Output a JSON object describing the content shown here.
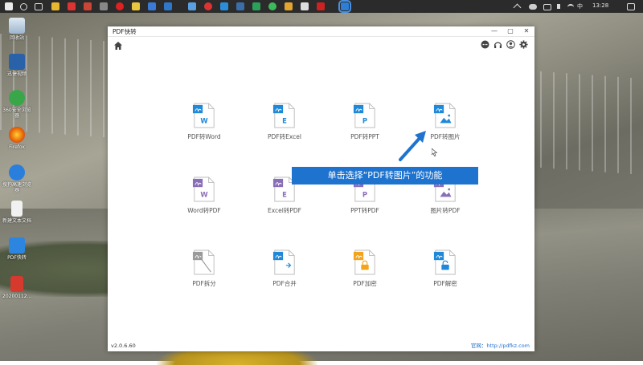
{
  "taskbar": {
    "tray": {
      "input_method": "中",
      "time": "13:28"
    }
  },
  "desktop": {
    "icons": [
      {
        "label": "回收站",
        "icon": "recycle-bin-icon"
      },
      {
        "label": "迅捷视频",
        "icon": "jm-app-icon"
      },
      {
        "label": "360安全浏览器",
        "icon": "360-browser-icon"
      },
      {
        "label": "Firefox",
        "icon": "firefox-icon"
      },
      {
        "label": "搜狗高速浏览器",
        "icon": "sogou-browser-icon"
      },
      {
        "label": "新建文本文档",
        "icon": "text-document-icon"
      },
      {
        "label": "PDF快转",
        "icon": "pdf-kuaizhuan-icon"
      },
      {
        "label": "20200112...",
        "icon": "pdf-file-icon"
      }
    ]
  },
  "window": {
    "title": "PDF快转",
    "controls": [
      "—",
      "▢",
      "✕"
    ],
    "toolbar_icons": [
      "chat-icon",
      "headset-icon",
      "user-icon",
      "gear-icon"
    ],
    "tiles": [
      {
        "label": "PDF转Word",
        "letter": "W",
        "accent": "#1f88d8"
      },
      {
        "label": "PDF转Excel",
        "letter": "E",
        "accent": "#1f88d8"
      },
      {
        "label": "PDF转PPT",
        "letter": "P",
        "accent": "#1f88d8"
      },
      {
        "label": "PDF转图片",
        "letter": "",
        "accent": "#1f88d8"
      },
      {
        "label": "Word转PDF",
        "letter": "W",
        "accent": "#8a6fb8"
      },
      {
        "label": "Excel转PDF",
        "letter": "E",
        "accent": "#8a6fb8"
      },
      {
        "label": "PPT转PDF",
        "letter": "P",
        "accent": "#8a6fb8"
      },
      {
        "label": "图片转PDF",
        "letter": "",
        "accent": "#8a6fb8"
      },
      {
        "label": "PDF拆分",
        "letter": "",
        "accent": "#9a9a9a"
      },
      {
        "label": "PDF合并",
        "letter": "",
        "accent": "#1f88d8"
      },
      {
        "label": "PDF加密",
        "letter": "",
        "accent": "#f2a51c"
      },
      {
        "label": "PDF解密",
        "letter": "",
        "accent": "#1f88d8"
      }
    ],
    "version": "v2.0.6.60",
    "website": "官网：http://pdfkz.com"
  },
  "annotation": {
    "callout_text": "单击选择“PDF转图片”的功能",
    "accent": "#1e73cf"
  }
}
